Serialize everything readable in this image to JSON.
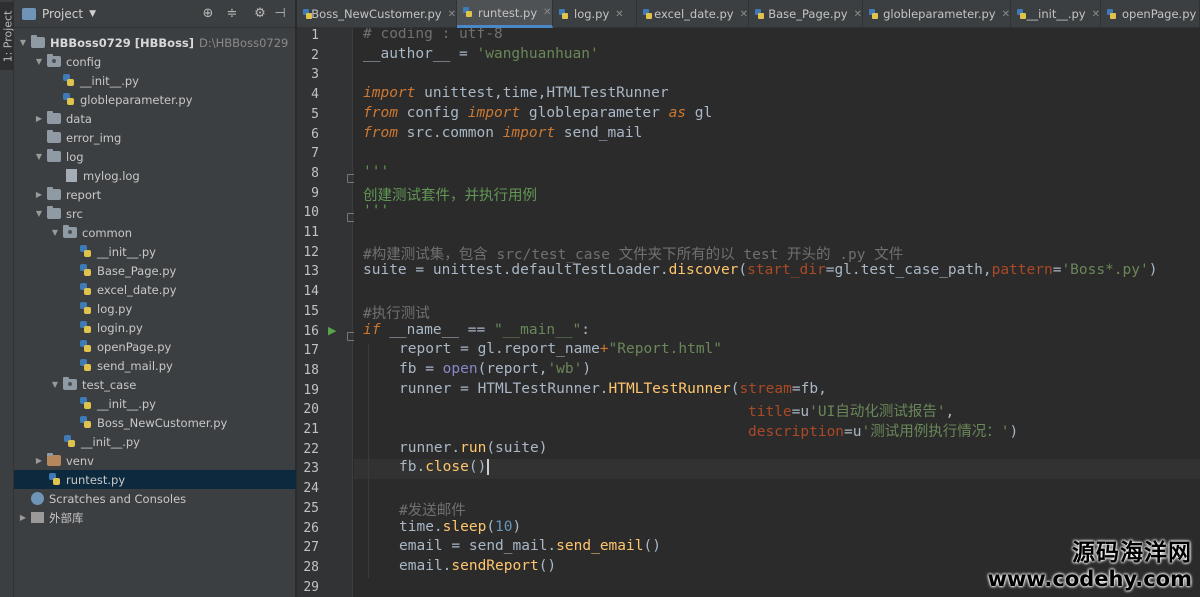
{
  "tool_window": {
    "vertical_tab": "1: Project"
  },
  "project_panel": {
    "title": "Project",
    "root_name": "HBBoss0729 [HBBoss]",
    "root_path": "D:\\HBBoss0729",
    "tree": [
      {
        "label": "config"
      },
      {
        "label": "__init__.py"
      },
      {
        "label": "globleparameter.py"
      },
      {
        "label": "data"
      },
      {
        "label": "error_img"
      },
      {
        "label": "log"
      },
      {
        "label": "mylog.log"
      },
      {
        "label": "report"
      },
      {
        "label": "src"
      },
      {
        "label": "common"
      },
      {
        "label": "__init__.py"
      },
      {
        "label": "Base_Page.py"
      },
      {
        "label": "excel_date.py"
      },
      {
        "label": "log.py"
      },
      {
        "label": "login.py"
      },
      {
        "label": "openPage.py"
      },
      {
        "label": "send_mail.py"
      },
      {
        "label": "test_case"
      },
      {
        "label": "__init__.py"
      },
      {
        "label": "Boss_NewCustomer.py"
      },
      {
        "label": "__init__.py"
      },
      {
        "label": "venv"
      },
      {
        "label": "runtest.py"
      },
      {
        "label": "Scratches and Consoles"
      },
      {
        "label": "外部库"
      }
    ]
  },
  "tabs": [
    {
      "label": "Boss_NewCustomer.py"
    },
    {
      "label": "runtest.py"
    },
    {
      "label": "log.py"
    },
    {
      "label": "excel_date.py"
    },
    {
      "label": "Base_Page.py"
    },
    {
      "label": "globleparameter.py"
    },
    {
      "label": "__init__.py"
    },
    {
      "label": "openPage.py"
    }
  ],
  "editor": {
    "line_numbers": [
      "1",
      "2",
      "3",
      "4",
      "5",
      "6",
      "7",
      "8",
      "9",
      "10",
      "11",
      "12",
      "13",
      "14",
      "15",
      "16",
      "17",
      "18",
      "19",
      "20",
      "21",
      "22",
      "23",
      "24",
      "25",
      "26",
      "27",
      "28",
      "29"
    ],
    "text": {
      "l1": "# coding : utf-8",
      "l2_a": "__author__ ",
      "l2_b": "= ",
      "l2_c": "'wanghuanhuan'",
      "l4_kw": "import",
      "l4_rest": " unittest,time,HTMLTestRunner",
      "l5_from": "from",
      "l5_mod": " config ",
      "l5_import": "import",
      "l5_name": " globleparameter ",
      "l5_as": "as",
      "l5_alias": " gl",
      "l6_from": "from",
      "l6_mod": " src.common ",
      "l6_import": "import",
      "l6_name": " send_mail",
      "l7": "'''",
      "l9": "创建测试套件，并执行用例",
      "l10": "'''",
      "l12": "#构建测试集，包含 src/test_case 文件夹下所有的以 test 开头的 .py 文件",
      "l13_a": "suite ",
      "l13_b": "= ",
      "l13_c": "unittest.defaultTestLoader.",
      "l13_fn": "discover",
      "l13_d": "(",
      "l13_p1": "start_dir",
      "l13_e": "=gl.test_case_path,",
      "l13_p2": "pattern",
      "l13_f": "=",
      "l13_s": "'Boss*.py'",
      "l13_g": ")",
      "l15": "#执行测试",
      "l16_if": "if",
      "l16_a": " __name__ ",
      "l16_op": "== ",
      "l16_s": "\"__main__\"",
      "l16_c": ":",
      "l17_a": "report ",
      "l17_op": "= ",
      "l17_b": "gl.report_name",
      "l17_plus": "+",
      "l17_s": "\"Report.html\"",
      "l18_a": "fb ",
      "l18_op": "= ",
      "l18_fn": "open",
      "l18_b": "(report,",
      "l18_s": "'wb'",
      "l18_c": ")",
      "l19_a": "runner ",
      "l19_op": "= ",
      "l19_b": "HTMLTestRunner.",
      "l19_fn": "HTMLTestRunner",
      "l19_c": "(",
      "l19_p": "stream",
      "l19_d": "=fb,",
      "l20_p": "title",
      "l20_a": "=u",
      "l20_s": "'UI自动化测试报告'",
      "l20_b": ",",
      "l21_p": "description",
      "l21_a": "=u",
      "l21_s": "'测试用例执行情况：'",
      "l21_b": ")",
      "l22_a": "runner.",
      "l22_fn": "run",
      "l22_b": "(suite)",
      "l23_a": "fb.",
      "l23_fn": "close",
      "l23_b": "()",
      "l25": "#发送邮件",
      "l26_a": "time.",
      "l26_fn": "sleep",
      "l26_b": "(",
      "l26_n": "10",
      "l26_c": ")",
      "l27_a": "email ",
      "l27_op": "= ",
      "l27_b": "send_mail.",
      "l27_fn": "send_email",
      "l27_c": "()",
      "l28_a": "email.",
      "l28_fn": "sendReport",
      "l28_b": "()"
    }
  },
  "watermark": {
    "line1": "源码海洋网",
    "line2": "www.codehy.com"
  },
  "colors": {
    "background": "#2b2b2b",
    "panel": "#3c3f41",
    "keyword": "#cc7832",
    "string": "#6a8759",
    "comment": "#808080",
    "function": "#ffc66d",
    "selection": "#0d293e"
  }
}
